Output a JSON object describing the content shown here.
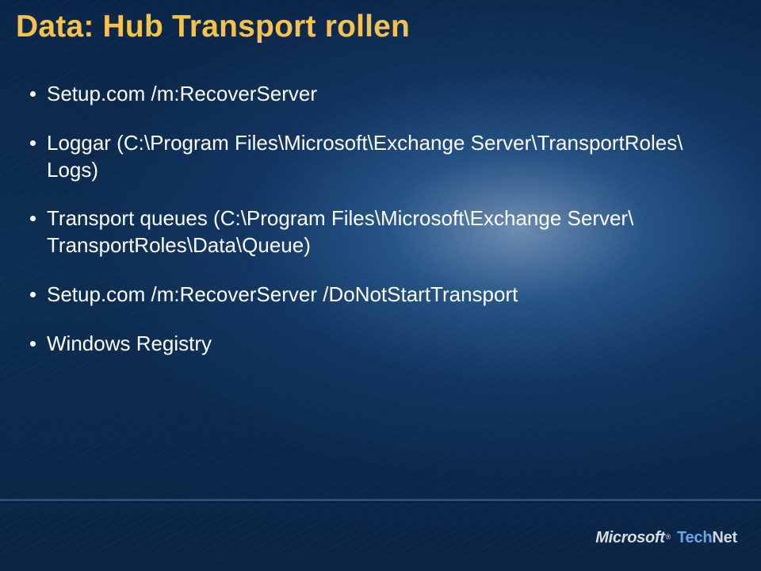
{
  "title": "Data: Hub Transport rollen",
  "bullets": [
    {
      "text": "Setup.com /m:RecoverServer"
    },
    {
      "text": "Loggar (C:\\Program Files\\Microsoft\\Exchange Server\\TransportRoles\\ Logs)"
    },
    {
      "text": "Transport queues (C:\\Program Files\\Microsoft\\Exchange Server\\ TransportRoles\\Data\\Queue)"
    },
    {
      "text": "Setup.com /m:RecoverServer /DoNotStartTransport"
    },
    {
      "text": "Windows Registry"
    }
  ],
  "logo": {
    "brand": "Microsoft",
    "registered": "®",
    "product_a": "Tech",
    "product_b": "Net"
  }
}
